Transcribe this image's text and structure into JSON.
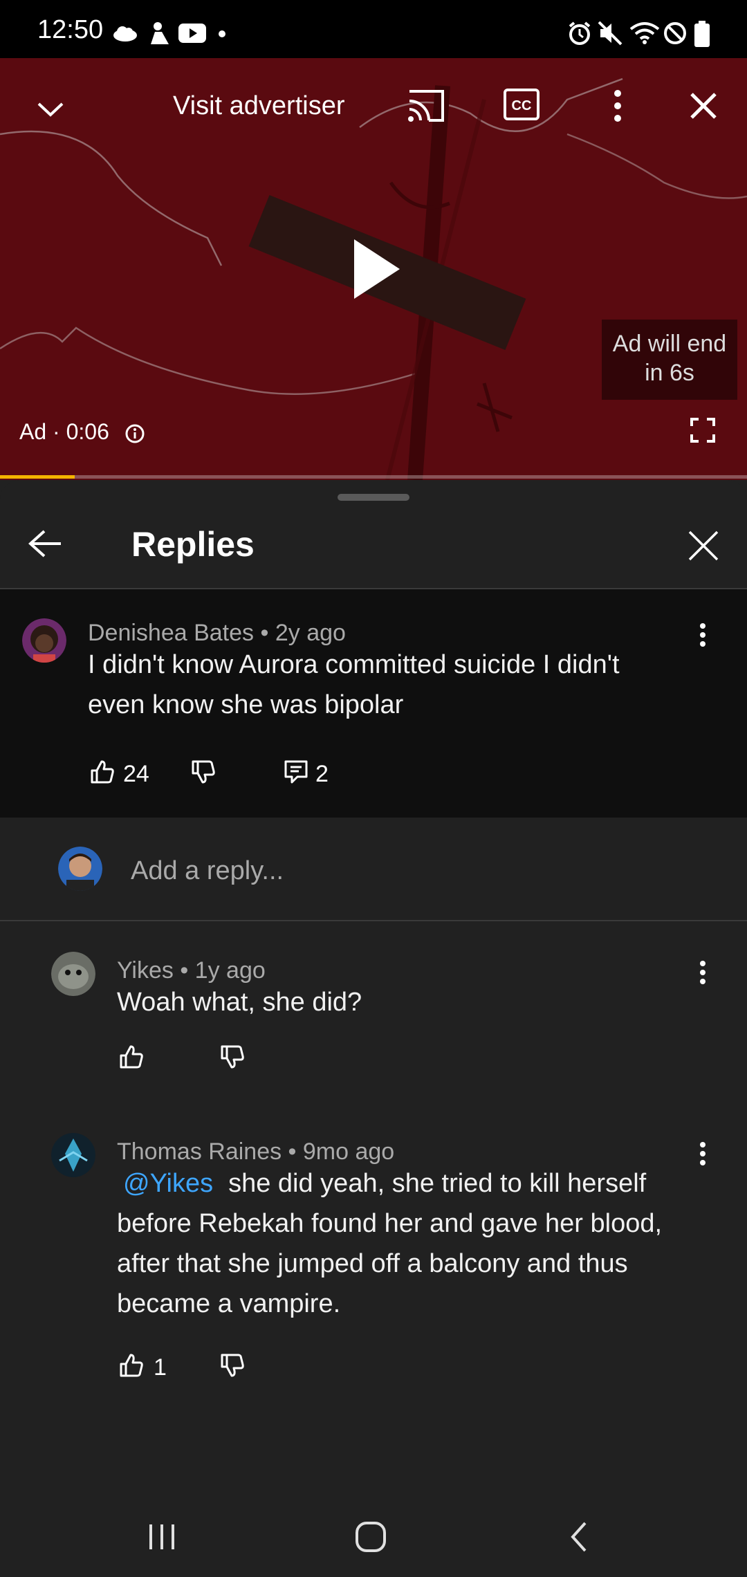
{
  "status_bar": {
    "time": "12:50"
  },
  "video_ad": {
    "visit_label": "Visit advertiser",
    "ad_time": "Ad · 0:06",
    "ad_end_line1": "Ad will end",
    "ad_end_line2": "in 6s",
    "progress_fraction": 0.1
  },
  "replies_panel": {
    "title": "Replies",
    "parent_comment": {
      "author": "Denishea Bates",
      "age": "2y ago",
      "meta": "Denishea Bates • 2y ago",
      "text_line1": "I didn't know Aurora committed suicide I didn't",
      "text_line2": "even know she was bipolar",
      "likes": "24",
      "replies": "2"
    },
    "add_reply": {
      "placeholder": "Add a reply..."
    },
    "replies": [
      {
        "meta": "Yikes • 1y ago",
        "text": "Woah what, she did?",
        "likes": ""
      },
      {
        "meta": "Thomas Raines • 9mo ago",
        "mention": "@Yikes",
        "text_line1": "she did yeah, she tried to kill herself",
        "text_line2": "before Rebekah found her and gave her blood,",
        "text_line3": "after that she jumped off a balcony and thus",
        "text_line4": "became a vampire.",
        "likes": "1"
      }
    ]
  }
}
